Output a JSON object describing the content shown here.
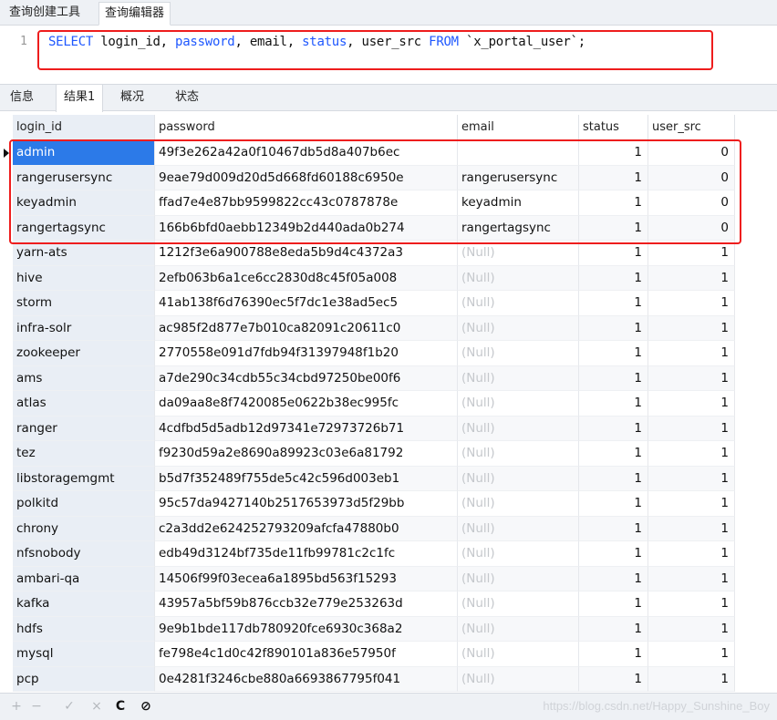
{
  "top_tabs": [
    "查询创建工具",
    "查询编辑器"
  ],
  "editor": {
    "line_number": "1",
    "tokens": [
      {
        "text": "SELECT",
        "kw": true
      },
      {
        "text": " login_id, ",
        "kw": false
      },
      {
        "text": "password",
        "kw": true
      },
      {
        "text": ", email, ",
        "kw": false
      },
      {
        "text": "status",
        "kw": true
      },
      {
        "text": ", user_src ",
        "kw": false
      },
      {
        "text": "FROM",
        "kw": true
      },
      {
        "text": " `x_portal_user`;",
        "kw": false
      }
    ]
  },
  "result_tabs": [
    "信息",
    "结果1",
    "概况",
    "状态"
  ],
  "grid": {
    "columns": [
      "login_id",
      "password",
      "email",
      "status",
      "user_src"
    ],
    "rows": [
      [
        "admin",
        "49f3e262a42a0f10467db5d8a407b6ec",
        "",
        "1",
        "0"
      ],
      [
        "rangerusersync",
        "9eae79d009d20d5d668fd60188c6950e",
        "rangerusersync",
        "1",
        "0"
      ],
      [
        "keyadmin",
        "ffad7e4e87bb9599822cc43c0787878e",
        "keyadmin",
        "1",
        "0"
      ],
      [
        "rangertagsync",
        "166b6bfd0aebb12349b2d440ada0b274",
        "rangertagsync",
        "1",
        "0"
      ],
      [
        "yarn-ats",
        "1212f3e6a900788e8eda5b9d4c4372a3",
        "(Null)",
        "1",
        "1"
      ],
      [
        "hive",
        "2efb063b6a1ce6cc2830d8c45f05a008",
        "(Null)",
        "1",
        "1"
      ],
      [
        "storm",
        "41ab138f6d76390ec5f7dc1e38ad5ec5",
        "(Null)",
        "1",
        "1"
      ],
      [
        "infra-solr",
        "ac985f2d877e7b010ca82091c20611c0",
        "(Null)",
        "1",
        "1"
      ],
      [
        "zookeeper",
        "2770558e091d7fdb94f31397948f1b20",
        "(Null)",
        "1",
        "1"
      ],
      [
        "ams",
        "a7de290c34cdb55c34cbd97250be00f6",
        "(Null)",
        "1",
        "1"
      ],
      [
        "atlas",
        "da09aa8e8f7420085e0622b38ec995fc",
        "(Null)",
        "1",
        "1"
      ],
      [
        "ranger",
        "4cdfbd5d5adb12d97341e72973726b71",
        "(Null)",
        "1",
        "1"
      ],
      [
        "tez",
        "f9230d59a2e8690a89923c03e6a81792",
        "(Null)",
        "1",
        "1"
      ],
      [
        "libstoragemgmt",
        "b5d7f352489f755de5c42c596d003eb1",
        "(Null)",
        "1",
        "1"
      ],
      [
        "polkitd",
        "95c57da9427140b2517653973d5f29bb",
        "(Null)",
        "1",
        "1"
      ],
      [
        "chrony",
        "c2a3dd2e624252793209afcfa47880b0",
        "(Null)",
        "1",
        "1"
      ],
      [
        "nfsnobody",
        "edb49d3124bf735de11fb99781c2c1fc",
        "(Null)",
        "1",
        "1"
      ],
      [
        "ambari-qa",
        "14506f99f03ecea6a1895bd563f15293",
        "(Null)",
        "1",
        "1"
      ],
      [
        "kafka",
        "43957a5bf59b876ccb32e779e253263d",
        "(Null)",
        "1",
        "1"
      ],
      [
        "hdfs",
        "9e9b1bde117db780920fce6930c368a2",
        "(Null)",
        "1",
        "1"
      ],
      [
        "mysql",
        "fe798e4c1d0c42f890101a836e57950f",
        "(Null)",
        "1",
        "1"
      ],
      [
        "pcp",
        "0e4281f3246cbe880a6693867795f041",
        "(Null)",
        "1",
        "1"
      ]
    ]
  },
  "bottom_toolbar": [
    {
      "name": "add-record-icon",
      "glyph": "+",
      "enabled": false
    },
    {
      "name": "delete-record-icon",
      "glyph": "−",
      "enabled": false
    },
    {
      "name": "apply-changes-icon",
      "glyph": "✓",
      "enabled": false
    },
    {
      "name": "discard-changes-icon",
      "glyph": "×",
      "enabled": false
    },
    {
      "name": "refresh-icon",
      "glyph": "C",
      "enabled": true
    },
    {
      "name": "stop-icon",
      "glyph": "⊘",
      "enabled": true
    }
  ],
  "watermark": "https://blog.csdn.net/Happy_Sunshine_Boy",
  "colors": {
    "keyword": "#1f58ff",
    "highlight_box": "#ee1d1d",
    "selected_cell": "#2c7ae8",
    "null_text": "#c5c8cc"
  }
}
